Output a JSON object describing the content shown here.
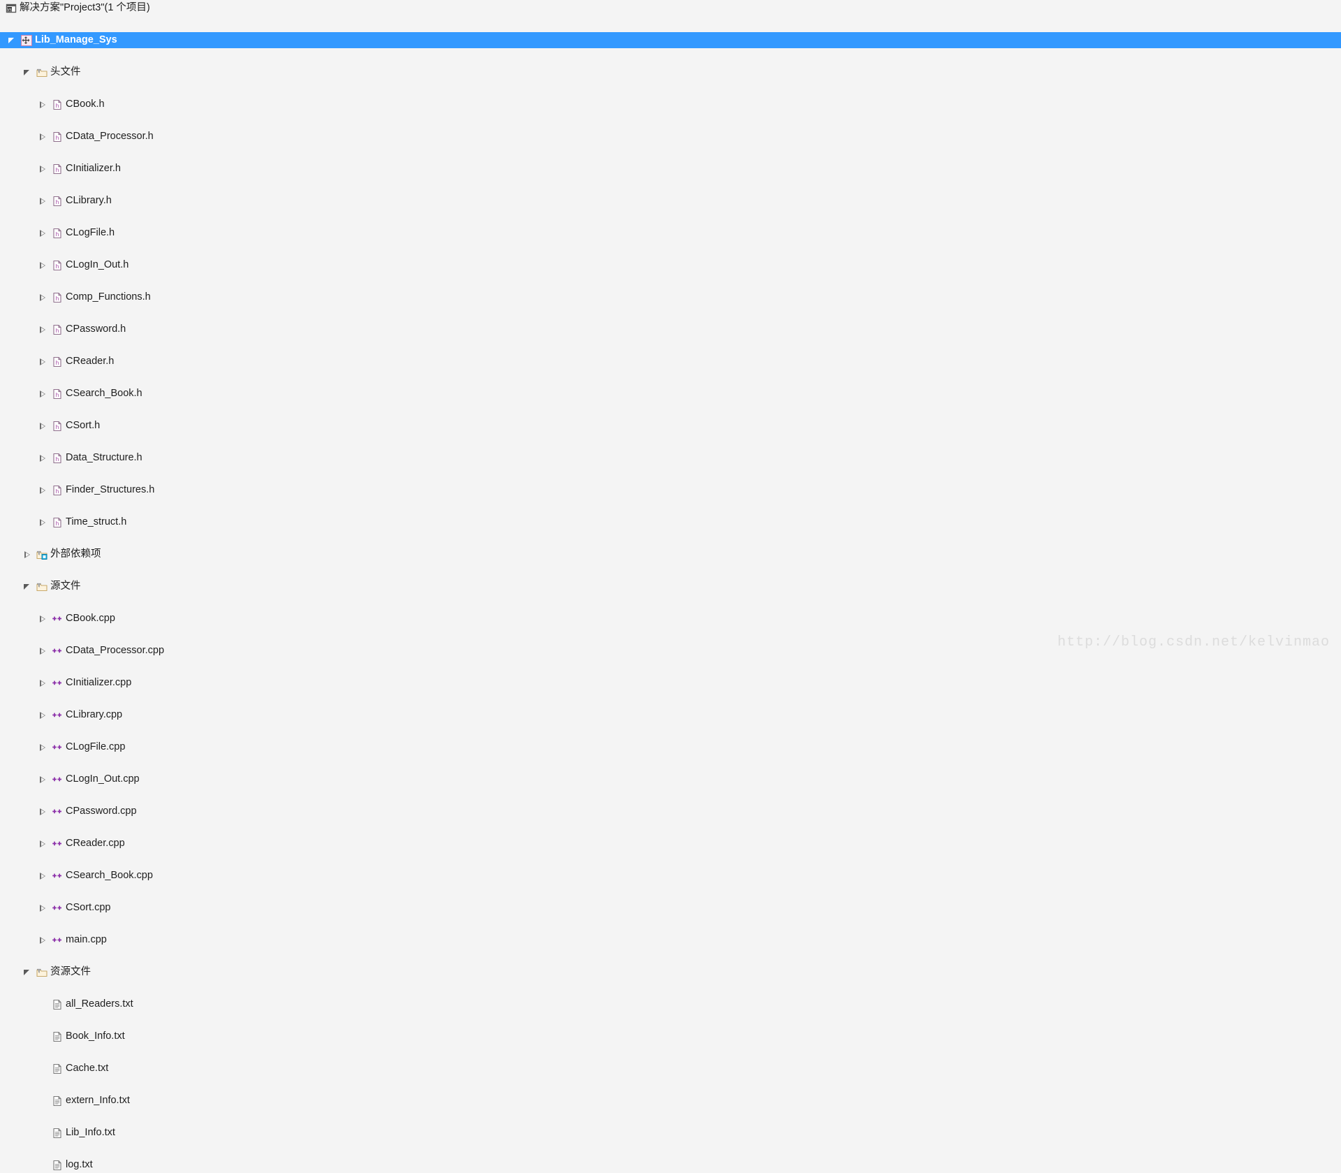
{
  "window": {
    "background_color": "#f4f4f4",
    "selection_color": "#3399ff",
    "text_color": "#1e1e1e"
  },
  "watermark": {
    "text": "http://blog.csdn.net/kelvinmao",
    "color": "#dcdcdc"
  },
  "solution_explorer": {
    "nodes": [
      {
        "label": "解决方案\"Project3\"(1 个项目)",
        "icon": "solution-icon",
        "depth": 0,
        "expander": "none",
        "selected": false
      },
      {
        "label": "Lib_Manage_Sys",
        "icon": "project-icon",
        "depth": 1,
        "expander": "expanded",
        "selected": true
      },
      {
        "label": "头文件",
        "icon": "filter-folder-icon",
        "depth": 2,
        "expander": "expanded",
        "selected": false
      },
      {
        "label": "CBook.h",
        "icon": "header-file-icon",
        "depth": 3,
        "expander": "collapsed",
        "selected": false
      },
      {
        "label": "CData_Processor.h",
        "icon": "header-file-icon",
        "depth": 3,
        "expander": "collapsed",
        "selected": false
      },
      {
        "label": "CInitializer.h",
        "icon": "header-file-icon",
        "depth": 3,
        "expander": "collapsed",
        "selected": false
      },
      {
        "label": "CLibrary.h",
        "icon": "header-file-icon",
        "depth": 3,
        "expander": "collapsed",
        "selected": false
      },
      {
        "label": "CLogFile.h",
        "icon": "header-file-icon",
        "depth": 3,
        "expander": "collapsed",
        "selected": false
      },
      {
        "label": "CLogIn_Out.h",
        "icon": "header-file-icon",
        "depth": 3,
        "expander": "collapsed",
        "selected": false
      },
      {
        "label": "Comp_Functions.h",
        "icon": "header-file-icon",
        "depth": 3,
        "expander": "collapsed",
        "selected": false
      },
      {
        "label": "CPassword.h",
        "icon": "header-file-icon",
        "depth": 3,
        "expander": "collapsed",
        "selected": false
      },
      {
        "label": "CReader.h",
        "icon": "header-file-icon",
        "depth": 3,
        "expander": "collapsed",
        "selected": false
      },
      {
        "label": "CSearch_Book.h",
        "icon": "header-file-icon",
        "depth": 3,
        "expander": "collapsed",
        "selected": false
      },
      {
        "label": "CSort.h",
        "icon": "header-file-icon",
        "depth": 3,
        "expander": "collapsed",
        "selected": false
      },
      {
        "label": "Data_Structure.h",
        "icon": "header-file-icon",
        "depth": 3,
        "expander": "collapsed",
        "selected": false
      },
      {
        "label": "Finder_Structures.h",
        "icon": "header-file-icon",
        "depth": 3,
        "expander": "collapsed",
        "selected": false
      },
      {
        "label": "Time_struct.h",
        "icon": "header-file-icon",
        "depth": 3,
        "expander": "collapsed",
        "selected": false
      },
      {
        "label": "外部依赖项",
        "icon": "external-dependencies-icon",
        "depth": 2,
        "expander": "collapsed",
        "selected": false
      },
      {
        "label": "源文件",
        "icon": "filter-folder-icon",
        "depth": 2,
        "expander": "expanded",
        "selected": false
      },
      {
        "label": "CBook.cpp",
        "icon": "cpp-file-icon",
        "depth": 3,
        "expander": "collapsed",
        "selected": false
      },
      {
        "label": "CData_Processor.cpp",
        "icon": "cpp-file-icon",
        "depth": 3,
        "expander": "collapsed",
        "selected": false
      },
      {
        "label": "CInitializer.cpp",
        "icon": "cpp-file-icon",
        "depth": 3,
        "expander": "collapsed",
        "selected": false
      },
      {
        "label": "CLibrary.cpp",
        "icon": "cpp-file-icon",
        "depth": 3,
        "expander": "collapsed",
        "selected": false
      },
      {
        "label": "CLogFile.cpp",
        "icon": "cpp-file-icon",
        "depth": 3,
        "expander": "collapsed",
        "selected": false
      },
      {
        "label": "CLogIn_Out.cpp",
        "icon": "cpp-file-icon",
        "depth": 3,
        "expander": "collapsed",
        "selected": false
      },
      {
        "label": "CPassword.cpp",
        "icon": "cpp-file-icon",
        "depth": 3,
        "expander": "collapsed",
        "selected": false
      },
      {
        "label": "CReader.cpp",
        "icon": "cpp-file-icon",
        "depth": 3,
        "expander": "collapsed",
        "selected": false
      },
      {
        "label": "CSearch_Book.cpp",
        "icon": "cpp-file-icon",
        "depth": 3,
        "expander": "collapsed",
        "selected": false
      },
      {
        "label": "CSort.cpp",
        "icon": "cpp-file-icon",
        "depth": 3,
        "expander": "collapsed",
        "selected": false
      },
      {
        "label": "main.cpp",
        "icon": "cpp-file-icon",
        "depth": 3,
        "expander": "collapsed",
        "selected": false
      },
      {
        "label": "资源文件",
        "icon": "filter-folder-icon",
        "depth": 2,
        "expander": "expanded",
        "selected": false
      },
      {
        "label": "all_Readers.txt",
        "icon": "text-file-icon",
        "depth": 3,
        "expander": "none",
        "selected": false
      },
      {
        "label": "Book_Info.txt",
        "icon": "text-file-icon",
        "depth": 3,
        "expander": "none",
        "selected": false
      },
      {
        "label": "Cache.txt",
        "icon": "text-file-icon",
        "depth": 3,
        "expander": "none",
        "selected": false
      },
      {
        "label": "extern_Info.txt",
        "icon": "text-file-icon",
        "depth": 3,
        "expander": "none",
        "selected": false
      },
      {
        "label": "Lib_Info.txt",
        "icon": "text-file-icon",
        "depth": 3,
        "expander": "none",
        "selected": false
      },
      {
        "label": "log.txt",
        "icon": "text-file-icon",
        "depth": 3,
        "expander": "none",
        "selected": false
      }
    ]
  }
}
